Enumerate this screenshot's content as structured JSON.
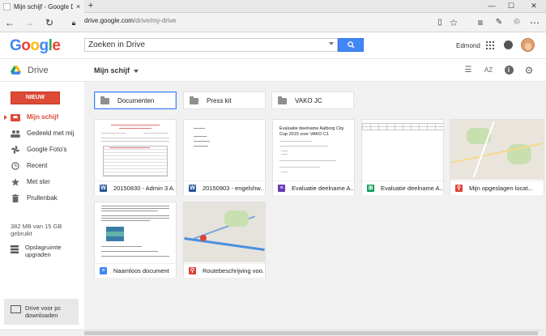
{
  "browser": {
    "tab_title": "Mijn schijf - Google Driv",
    "tab_close": "×",
    "new_tab": "+",
    "url_domain": "drive.google.com",
    "url_path": "/drive/my-drive",
    "window_buttons": [
      "—",
      "☐",
      "✕"
    ]
  },
  "google_bar": {
    "logo_letters": [
      {
        "ch": "G",
        "color": "#4285f4"
      },
      {
        "ch": "o",
        "color": "#ea4335"
      },
      {
        "ch": "o",
        "color": "#fbbc05"
      },
      {
        "ch": "g",
        "color": "#4285f4"
      },
      {
        "ch": "l",
        "color": "#34a853"
      },
      {
        "ch": "e",
        "color": "#ea4335"
      }
    ],
    "search_value": "Zoeken in Drive",
    "search_button_icon": "search-icon",
    "user_name": "Edmond"
  },
  "toolbar": {
    "app_name": "Drive",
    "breadcrumb": "Mijn schijf",
    "view_icons": [
      "list-view-icon",
      "sort-az-icon",
      "info-icon",
      "settings-icon"
    ],
    "sort_label": "AZ"
  },
  "sidebar": {
    "new_button": "NIEUW",
    "items": [
      {
        "label": "Mijn schijf",
        "icon": "my-drive-icon",
        "active": true
      },
      {
        "label": "Gedeeld met mij",
        "icon": "shared-people-icon",
        "active": false
      },
      {
        "label": "Google Foto's",
        "icon": "photos-pinwheel-icon",
        "active": false
      },
      {
        "label": "Recent",
        "icon": "clock-icon",
        "active": false
      },
      {
        "label": "Met ster",
        "icon": "star-icon",
        "active": false
      },
      {
        "label": "Prullenbak",
        "icon": "trash-icon",
        "active": false
      }
    ],
    "quota": "382 MB van 15 GB gebruikt",
    "upgrade": "Opslagruimte upgraden",
    "pc_download": "Drive voor pc downloaden"
  },
  "folders": [
    {
      "name": "Documenten",
      "selected": true,
      "shared": false
    },
    {
      "name": "Press kit",
      "selected": false,
      "shared": true
    },
    {
      "name": "VAKO JC",
      "selected": false,
      "shared": true
    }
  ],
  "files": [
    {
      "name": "20150830 - Admin 3 A...",
      "type": "word",
      "icon_label": "W",
      "color": "#2a5699"
    },
    {
      "name": "20150903 - engelshw...",
      "type": "word",
      "icon_label": "W",
      "color": "#2a5699"
    },
    {
      "name": "Evaluatie deelname A...",
      "type": "form",
      "icon_label": "≡",
      "color": "#673ab7"
    },
    {
      "name": "Evaluatie deelname A...",
      "type": "sheet",
      "icon_label": "⊞",
      "color": "#0f9d58"
    },
    {
      "name": "Mijn opgeslagen locat...",
      "type": "map",
      "icon_label": "⚲",
      "color": "#db4437"
    },
    {
      "name": "Naamloos document",
      "type": "doc",
      "icon_label": "≡",
      "color": "#4285f4"
    },
    {
      "name": "Routebeschrijving voo...",
      "type": "map",
      "icon_label": "⚲",
      "color": "#db4437"
    }
  ],
  "thumb_text": {
    "form_title": "Evaluatie deelname Aalborg City Cup 2015 voor VAKO C1"
  }
}
